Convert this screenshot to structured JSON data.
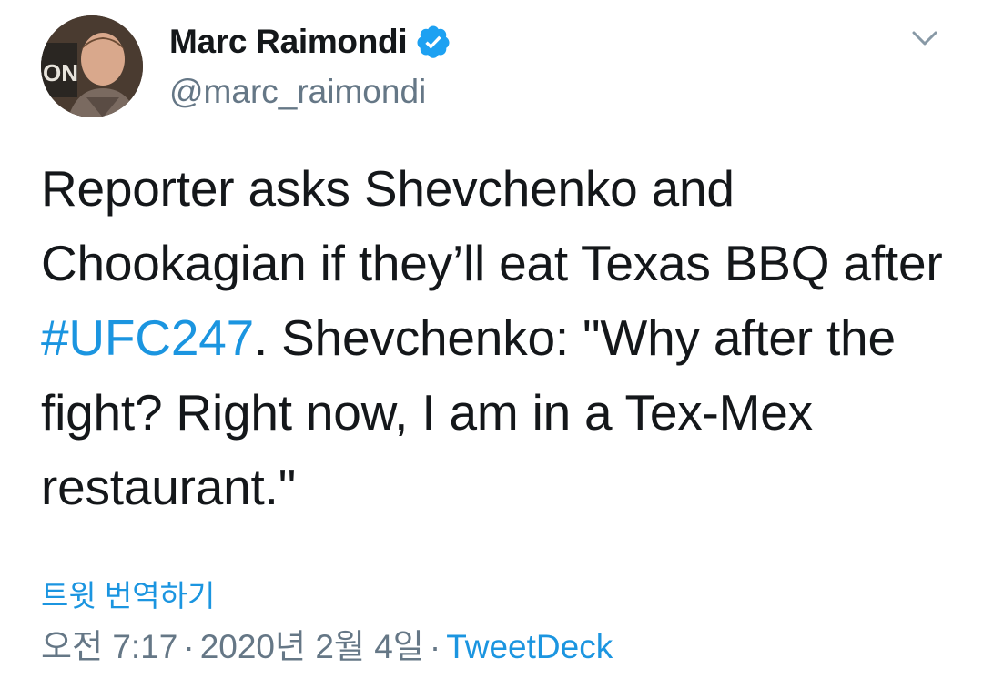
{
  "author": {
    "display_name": "Marc Raimondi",
    "handle": "@marc_raimondi",
    "verified": true,
    "avatar_icon": "profile-photo"
  },
  "menu": {
    "icon": "chevron-down-icon"
  },
  "tweet": {
    "text_before_hashtag": "Reporter asks Shevchenko and Chookagian if they’ll eat Texas BBQ after ",
    "hashtag": "#UFC247",
    "text_after_hashtag": ". Shevchenko: \"Why after the fight? Right now, I am in a Tex-Mex restaurant.\""
  },
  "translate_label": "트윗 번역하기",
  "meta": {
    "time": "오전 7:17",
    "separator": "·",
    "date": "2020년 2월 4일",
    "source": "TweetDeck"
  },
  "colors": {
    "text": "#14171a",
    "secondary": "#657786",
    "link": "#1b95e0",
    "verified": "#1da1f2"
  }
}
